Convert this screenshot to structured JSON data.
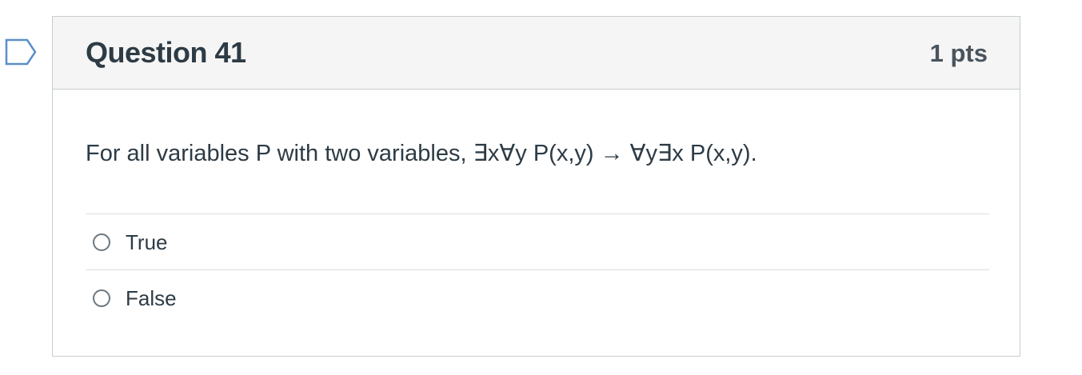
{
  "question": {
    "title": "Question 41",
    "points": "1 pts",
    "text": "For all variables P with two variables, ∃x∀y P(x,y) → ∀y∃x P(x,y).",
    "answers": [
      {
        "label": "True",
        "selected": false
      },
      {
        "label": "False",
        "selected": false
      }
    ]
  },
  "colors": {
    "header_bg": "#f5f5f5",
    "border": "#c7cdd1",
    "text": "#2d3b45",
    "flag_outline": "#5b8fc7"
  },
  "icons": {
    "flag": "flag-question-icon"
  }
}
